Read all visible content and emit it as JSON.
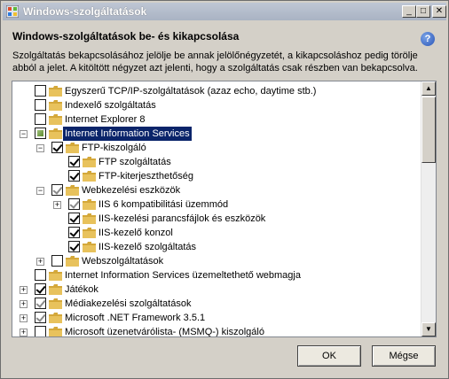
{
  "window": {
    "title": "Windows-szolgáltatások",
    "title_icon": "windows-features-icon",
    "controls": {
      "minimize": "_",
      "maximize": "□",
      "close": "✕"
    }
  },
  "heading": "Windows-szolgáltatások be- és kikapcsolása",
  "help_label": "?",
  "description": "Szolgáltatás bekapcsolásához jelölje be annak jelölőnégyzetét, a kikapcsoláshoz pedig törölje abból a jelet. A kitöltött négyzet azt jelenti, hogy a szolgáltatás csak részben van bekapcsolva.",
  "tree": [
    {
      "label": "Egyszerű TCP/IP-szolgáltatások (azaz echo, daytime stb.)",
      "level": 0,
      "expander": "",
      "state": "unchecked"
    },
    {
      "label": "Indexelő szolgáltatás",
      "level": 0,
      "expander": "",
      "state": "unchecked"
    },
    {
      "label": "Internet Explorer 8",
      "level": 0,
      "expander": "",
      "state": "unchecked"
    },
    {
      "label": "Internet Information Services",
      "level": 0,
      "expander": "−",
      "state": "partial",
      "selected": true
    },
    {
      "label": "FTP-kiszolgáló",
      "level": 1,
      "expander": "−",
      "state": "checked"
    },
    {
      "label": "FTP szolgáltatás",
      "level": 2,
      "expander": "",
      "state": "checked"
    },
    {
      "label": "FTP-kiterjeszthetőség",
      "level": 2,
      "expander": "",
      "state": "checked"
    },
    {
      "label": "Webkezelési eszközök",
      "level": 1,
      "expander": "−",
      "state": "partial-check"
    },
    {
      "label": "IIS 6 kompatibilitási üzemmód",
      "level": 2,
      "expander": "+",
      "state": "partial-check"
    },
    {
      "label": "IIS-kezelési parancsfájlok és eszközök",
      "level": 2,
      "expander": "",
      "state": "checked"
    },
    {
      "label": "IIS-kezelő konzol",
      "level": 2,
      "expander": "",
      "state": "checked"
    },
    {
      "label": "IIS-kezelő szolgáltatás",
      "level": 2,
      "expander": "",
      "state": "checked"
    },
    {
      "label": "Webszolgáltatások",
      "level": 1,
      "expander": "+",
      "state": "unchecked"
    },
    {
      "label": "Internet Information Services üzemeltethető webmagja",
      "level": 0,
      "expander": "",
      "state": "unchecked"
    },
    {
      "label": "Játékok",
      "level": 0,
      "expander": "+",
      "state": "checked"
    },
    {
      "label": "Médiakezelési szolgáltatások",
      "level": 0,
      "expander": "+",
      "state": "partial-check"
    },
    {
      "label": "Microsoft .NET Framework 3.5.1",
      "level": 0,
      "expander": "+",
      "state": "partial-check"
    },
    {
      "label": "Microsoft üzenetvárólista- (MSMQ-) kiszolgáló",
      "level": 0,
      "expander": "+",
      "state": "unchecked"
    }
  ],
  "buttons": {
    "ok": "OK",
    "cancel": "Mégse"
  },
  "colors": {
    "folder": "#e8c25c",
    "selection": "#0a246a",
    "titlebar": "#a9b3c3"
  }
}
